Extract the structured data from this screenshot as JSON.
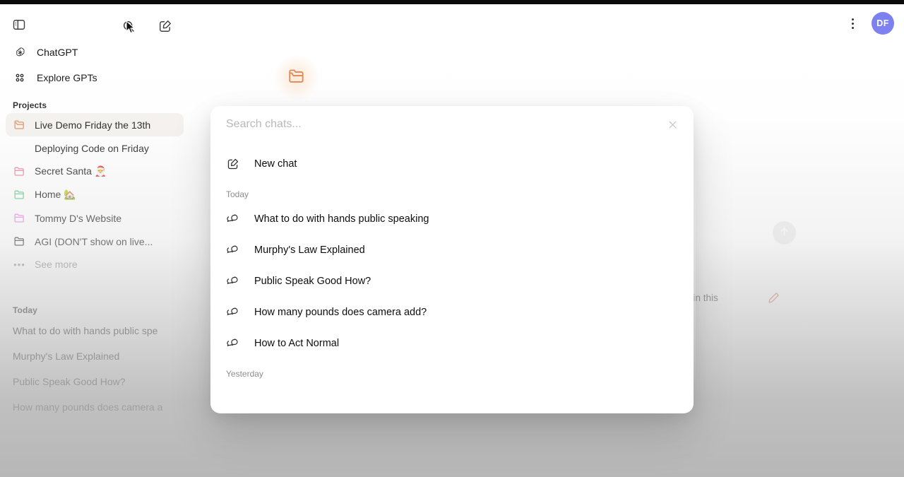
{
  "header": {
    "sidebar_toggle_label": "Toggle sidebar",
    "search_label": "Search chats",
    "new_chat_label": "New chat",
    "more_options_label": "More options",
    "avatar_initials": "DF"
  },
  "sidebar": {
    "nav": [
      {
        "label": "ChatGPT",
        "icon": "chatgpt-logo-icon"
      },
      {
        "label": "Explore GPTs",
        "icon": "grid-apps-icon"
      }
    ],
    "projects_heading": "Projects",
    "projects": [
      {
        "label": "Live Demo Friday the 13th",
        "icon": "folder-open-icon",
        "color": "#e08a50",
        "active": true,
        "nested": false
      },
      {
        "label": "Deploying Code on Friday",
        "icon": "none",
        "color": "",
        "active": false,
        "nested": true
      },
      {
        "label": "Secret Santa 🎅",
        "icon": "folder-icon",
        "color": "#f2798f",
        "active": false,
        "nested": false
      },
      {
        "label": "Home 🏡",
        "icon": "folder-icon",
        "color": "#57c97e",
        "active": false,
        "nested": false
      },
      {
        "label": "Tommy D's Website",
        "icon": "folder-icon",
        "color": "#e87ce0",
        "active": false,
        "nested": false
      },
      {
        "label": "AGI (DON'T show on live...",
        "icon": "folder-icon",
        "color": "#2b2b2b",
        "active": false,
        "nested": false
      }
    ],
    "see_more_label": "See more",
    "today_heading": "Today",
    "today_chats": [
      {
        "label": "What to do with hands public spe"
      },
      {
        "label": "Murphy's Law Explained"
      },
      {
        "label": "Public Speak Good How?"
      },
      {
        "label": "How many pounds does camera a"
      }
    ]
  },
  "canvas": {
    "project_icon": "folder-open-icon",
    "project_icon_color": "#d9814a",
    "send_button_label": "Send message",
    "files_note": "ls in this",
    "edit_icon_label": "edit-instructions",
    "edit_icon_color": "#d9754a"
  },
  "modal": {
    "search_placeholder": "Search chats...",
    "search_value": "",
    "close_label": "Close search",
    "new_chat": {
      "label": "New chat",
      "icon": "compose-icon"
    },
    "groups": [
      {
        "label": "Today",
        "items": [
          {
            "label": "What to do with hands public speaking",
            "icon": "chat-bubbles-icon"
          },
          {
            "label": "Murphy's Law Explained",
            "icon": "chat-bubbles-icon"
          },
          {
            "label": "Public Speak Good How?",
            "icon": "chat-bubbles-icon"
          },
          {
            "label": "How many pounds does camera add?",
            "icon": "chat-bubbles-icon"
          },
          {
            "label": "How to Act Normal",
            "icon": "chat-bubbles-icon"
          }
        ]
      },
      {
        "label": "Yesterday",
        "items": []
      }
    ]
  },
  "colors": {
    "accent_orange": "#d9814a",
    "avatar_bg": "#7b7ff0",
    "active_row_bg": "#f4f1ee"
  }
}
